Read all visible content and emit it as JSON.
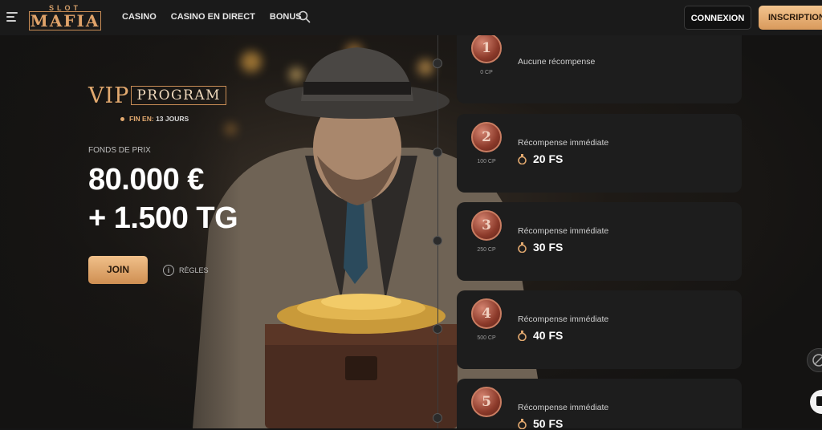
{
  "header": {
    "logo_top": "SLOT",
    "logo_main": "MAFIA",
    "nav": [
      "CASINO",
      "CASINO EN DIRECT",
      "BONUS"
    ],
    "login_label": "CONNEXION",
    "register_label": "INSCRIPTION"
  },
  "promo": {
    "vip": "VIP",
    "program": "PROGRAM",
    "ends_label": "FIN EN:",
    "ends_value": "13 JOURS",
    "prize_label": "FONDS DE PRIX",
    "prize_main": "80.000 €",
    "prize_extra": "+ 1.500 TG",
    "join_label": "JOIN",
    "rules_label": "RÈGLES"
  },
  "levels": [
    {
      "number": "1",
      "cp": "0 CP",
      "reward_label": "Aucune récompense",
      "reward_value": ""
    },
    {
      "number": "2",
      "cp": "100 CP",
      "reward_label": "Récompense immédiate",
      "reward_value": "20 FS"
    },
    {
      "number": "3",
      "cp": "250 CP",
      "reward_label": "Récompense immédiate",
      "reward_value": "30 FS"
    },
    {
      "number": "4",
      "cp": "500 CP",
      "reward_label": "Récompense immédiate",
      "reward_value": "40 FS"
    },
    {
      "number": "5",
      "cp": "",
      "reward_label": "Récompense immédiate",
      "reward_value": "50 FS"
    }
  ],
  "colors": {
    "accent": "#e2a96f",
    "background": "#151515",
    "card": "#1d1d1d"
  }
}
